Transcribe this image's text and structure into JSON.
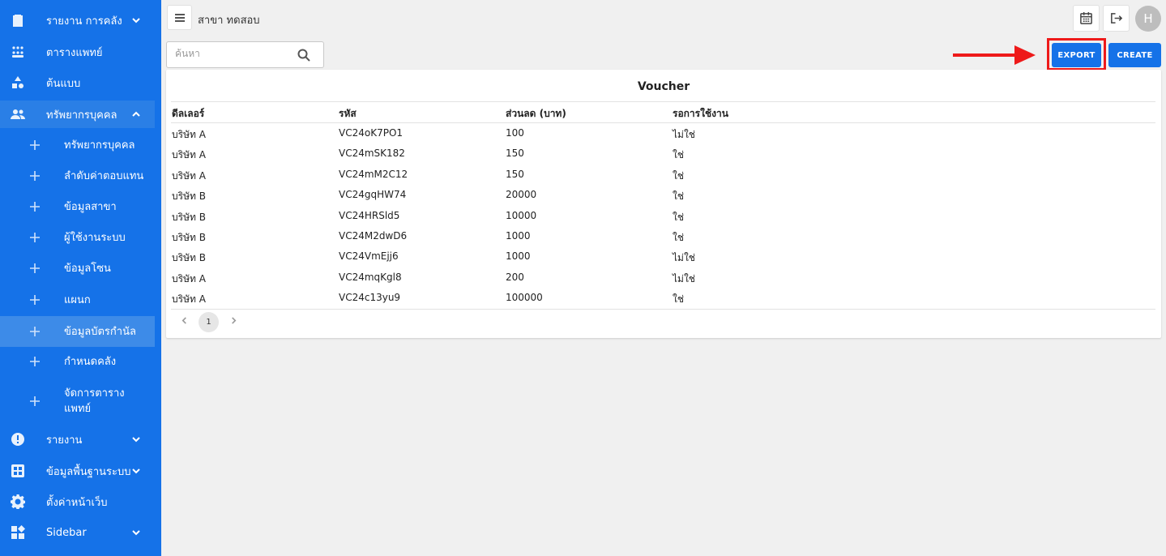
{
  "sidebar": {
    "items": [
      {
        "label": "รายงาน การคลัง",
        "icon": "clipboard-icon",
        "chevron": "down"
      },
      {
        "label": "ตารางแพทย์",
        "icon": "people-group-icon"
      },
      {
        "label": "ต้นแบบ",
        "icon": "shapes-icon"
      },
      {
        "label": "ทรัพยากรบุคคล",
        "icon": "people-icon",
        "chevron": "up",
        "active": true
      },
      {
        "label": "ทรัพยากรบุคคล",
        "sub": true
      },
      {
        "label": "ลำดับค่าตอบแทน",
        "sub": true
      },
      {
        "label": "ข้อมูลสาขา",
        "sub": true
      },
      {
        "label": "ผู้ใช้งานระบบ",
        "sub": true
      },
      {
        "label": "ข้อมูลโซน",
        "sub": true
      },
      {
        "label": "แผนก",
        "sub": true
      },
      {
        "label": "ข้อมูลบัตรกำนัล",
        "sub": true,
        "active": true
      },
      {
        "label": "กำหนดคลัง",
        "sub": true
      },
      {
        "label": "จัดการตาราง\nแพทย์",
        "sub": true
      },
      {
        "label": "รายงาน",
        "icon": "alert-circle-icon",
        "chevron": "down"
      },
      {
        "label": "ข้อมูลพื้นฐานระบบ",
        "icon": "grid-icon",
        "chevron": "down"
      },
      {
        "label": "ตั้งค่าหน้าเว็บ",
        "icon": "gear-icon"
      },
      {
        "label": "Sidebar",
        "icon": "widgets-icon",
        "chevron": "down"
      }
    ]
  },
  "topbar": {
    "branch": "สาขา ทดสอบ",
    "avatar_initial": "H"
  },
  "search": {
    "placeholder": "ค้นหา"
  },
  "buttons": {
    "export": "EXPORT",
    "create": "CREATE"
  },
  "colors": {
    "sidebar": "#1572e8",
    "primary_button": "#1572e8",
    "highlight": "#ee1a1a"
  },
  "table": {
    "title": "Voucher",
    "columns": [
      "ดีลเลอร์",
      "รหัส",
      "ส่วนลด (บาท)",
      "รอการใช้งาน"
    ],
    "rows": [
      [
        "บริษัท A",
        "VC24oK7PO1",
        "100",
        "ไม่ใช่"
      ],
      [
        "บริษัท A",
        "VC24mSK182",
        "150",
        "ใช่"
      ],
      [
        "บริษัท A",
        "VC24mM2C12",
        "150",
        "ใช่"
      ],
      [
        "บริษัท B",
        "VC24gqHW74",
        "20000",
        "ใช่"
      ],
      [
        "บริษัท B",
        "VC24HRSld5",
        "10000",
        "ใช่"
      ],
      [
        "บริษัท B",
        "VC24M2dwD6",
        "1000",
        "ใช่"
      ],
      [
        "บริษัท B",
        "VC24VmEjj6",
        "1000",
        "ไม่ใช่"
      ],
      [
        "บริษัท A",
        "VC24mqKgl8",
        "200",
        "ไม่ใช่"
      ],
      [
        "บริษัท A",
        "VC24c13yu9",
        "100000",
        "ใช่"
      ]
    ]
  },
  "pagination": {
    "current": "1"
  }
}
